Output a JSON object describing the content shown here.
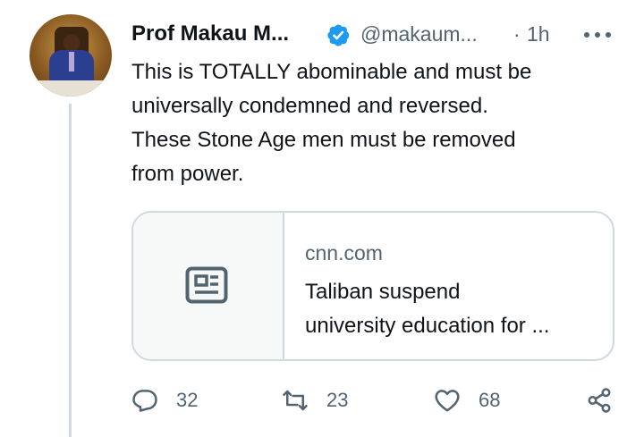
{
  "tweet": {
    "author_name": "Prof Makau M...",
    "handle": "@makaum...",
    "separator": "·",
    "time": "1h",
    "lines": [
      "This is TOTALLY abominable and must be",
      "universally condemned and reversed.",
      "These Stone Age men must be removed",
      "from power."
    ]
  },
  "card": {
    "domain": "cnn.com",
    "title_lines": [
      "Taliban suspend",
      "university education for ..."
    ],
    "thumb_icon": "newspaper-icon"
  },
  "actions": {
    "replies": "32",
    "retweets": "23",
    "likes": "68"
  },
  "colors": {
    "text": "#0f1419",
    "secondary": "#536471",
    "verified": "#1d9bf0",
    "border": "#cfd9de"
  }
}
